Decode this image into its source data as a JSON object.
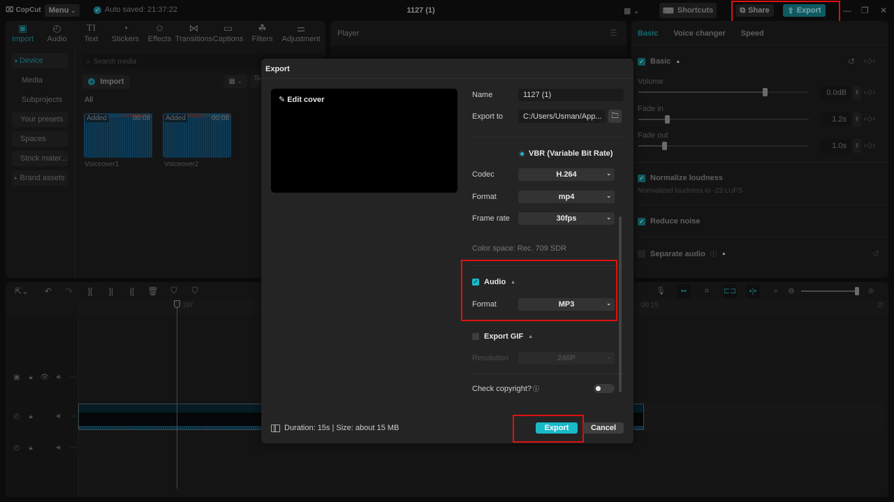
{
  "app": {
    "logo": "CopCut",
    "menu_label": "Menu",
    "autosave": "Auto saved: 21:37:22",
    "project_title": "1127 (1)",
    "shortcuts_label": "Shortcuts",
    "share_label": "Share",
    "export_label": "Export"
  },
  "tool_tabs": [
    {
      "label": "Import",
      "icon": "import-icon",
      "glyph": "▣",
      "active": true
    },
    {
      "label": "Audio",
      "icon": "audio-icon",
      "glyph": "◴",
      "active": false
    },
    {
      "label": "Text",
      "icon": "text-icon",
      "glyph": "TI",
      "active": false
    },
    {
      "label": "Stickers",
      "icon": "stickers-icon",
      "glyph": "◔",
      "active": false
    },
    {
      "label": "Effects",
      "icon": "effects-icon",
      "glyph": "✩",
      "active": false
    },
    {
      "label": "Transitions",
      "icon": "transitions-icon",
      "glyph": "⋈",
      "active": false
    },
    {
      "label": "Captions",
      "icon": "captions-icon",
      "glyph": "▭",
      "active": false
    },
    {
      "label": "Filters",
      "icon": "filters-icon",
      "glyph": "☘",
      "active": false
    },
    {
      "label": "Adjustment",
      "icon": "adjustment-icon",
      "glyph": "⚌",
      "active": false
    }
  ],
  "sidebar": {
    "items": [
      {
        "label": "Device",
        "prefix": "▾"
      },
      {
        "label": "Media"
      },
      {
        "label": "Subprojects"
      },
      {
        "label": "Your presets"
      },
      {
        "label": "Spaces"
      },
      {
        "label": "Stock mater..."
      },
      {
        "label": "Brand assets",
        "prefix": "▸"
      }
    ]
  },
  "media": {
    "search_placeholder": "Search media",
    "import_label": "Import",
    "sort_label": "So",
    "all_label": "All",
    "items": [
      {
        "name": "Voiceover1",
        "badge": "Added",
        "duration": "00:08"
      },
      {
        "name": "Voiceover2",
        "badge": "Added",
        "duration": "00:08"
      }
    ]
  },
  "player": {
    "title": "Player"
  },
  "right_panel": {
    "tabs": [
      "Basic",
      "Voice changer",
      "Speed"
    ],
    "basic_label": "Basic",
    "volume": {
      "label": "Volume",
      "value": "0.0dB",
      "position": 0.74
    },
    "fade_in": {
      "label": "Fade in",
      "value": "1.2s",
      "position": 0.17
    },
    "fade_out": {
      "label": "Fade out",
      "value": "1.0s",
      "position": 0.15
    },
    "normalize": {
      "label": "Normalize loudness",
      "desc": "Normalized loudness to -23 LUFS",
      "checked": true
    },
    "reduce_noise": {
      "label": "Reduce noise",
      "checked": true
    },
    "separate_audio": {
      "label": "Separate audio",
      "checked": false
    }
  },
  "timeline": {
    "ruler_left": "26f",
    "ruler_mid": "00:15",
    "ruler_right": "2f"
  },
  "export_dialog": {
    "title": "Export",
    "edit_cover": "Edit cover",
    "name_label": "Name",
    "name_value": "1127 (1)",
    "export_to_label": "Export to",
    "export_to_value": "C:/Users/Usman/App...",
    "bitrate_option": "VBR (Variable Bit Rate)",
    "codec_label": "Codec",
    "codec_value": "H.264",
    "format_label": "Format",
    "format_value": "mp4",
    "frame_rate_label": "Frame rate",
    "frame_rate_value": "30fps",
    "color_space": "Color space: Rec. 709 SDR",
    "audio_section": "Audio",
    "audio_checked": true,
    "audio_format_label": "Format",
    "audio_format_value": "MP3",
    "gif_section": "Export GIF",
    "gif_checked": false,
    "resolution_label": "Resolution",
    "resolution_value": "240P",
    "copyright_label": "Check copyright?",
    "copyright_on": false,
    "duration_info": "Duration: 15s | Size: about 15 MB",
    "export_button": "Export",
    "cancel_button": "Cancel"
  }
}
